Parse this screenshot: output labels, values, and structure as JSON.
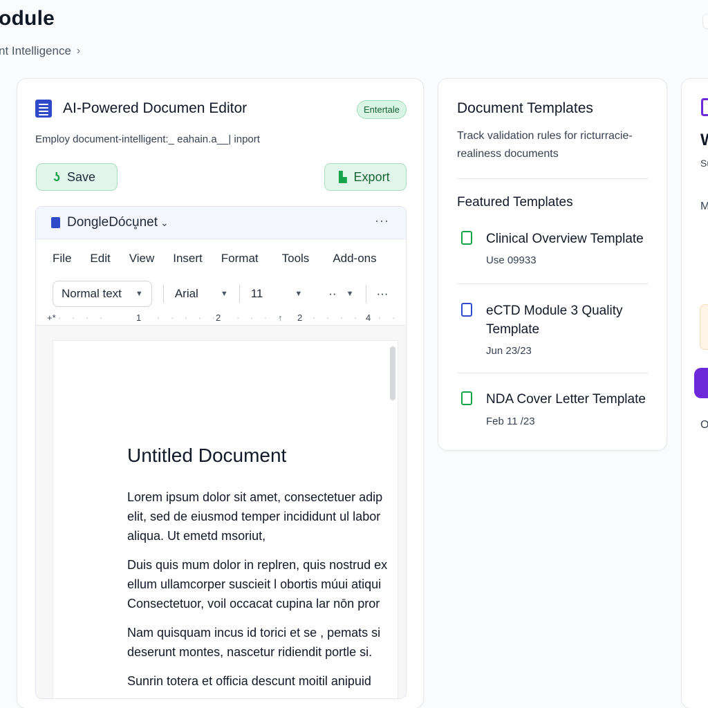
{
  "header": {
    "title_partial": "odule",
    "breadcrumb": "nt Intelligence",
    "breadcrumb_sep": "›"
  },
  "editor": {
    "title": "AI-Powered Documen Editor",
    "badge": "Entertale",
    "subtitle": "Employ document-intelligent:_ eahain.a__| inport",
    "save_label": "Save",
    "export_label": "Export",
    "doc_name": "DongleDócu̥net",
    "more": "···",
    "menu": [
      "File",
      "Edit",
      "View",
      "Insert",
      "Format",
      "Tools",
      "Add-ons"
    ],
    "toolbar": {
      "style": "Normal text",
      "font": "Arial",
      "size": "11",
      "extra": "··",
      "more": "···"
    },
    "ruler": [
      "+*",
      "1",
      "2",
      "2",
      "4"
    ],
    "doc": {
      "heading": "Untitled Document",
      "paragraphs": [
        [
          "Lorem ipsum dolor sit amet, consectetuer adip",
          "elit, sed de eiusmod temper incididunt ul labor",
          "aliqua. Ut emetd msoriut,"
        ],
        [
          "Duis quis mum dolor in replren, quis nostrud ex",
          "ellum ullamcorper susciеit l obortis múui atiqui",
          "Consectetuor, voil occacat cupina lar nōn pror"
        ],
        [
          "Nam quisquam incus id torici et se , pemats si",
          "deserunt montes, nascetur ridiendit portle si."
        ],
        [
          "Sunrin totera et officia descunt moitil anipuid"
        ]
      ]
    }
  },
  "templates": {
    "title": "Document Templates",
    "description": "Track validation rules for ricturracie-realiness documents",
    "featured_label": "Featured Templates",
    "items": [
      {
        "name": "Clinical Overview Template",
        "date": "Use 09933",
        "icon": "document-icon"
      },
      {
        "name": "eCTD Module 3 Quality Template",
        "date": "Jun 23/23",
        "icon": "document-icon"
      },
      {
        "name": "NDA Cover Letter Template",
        "date": "Feb 11 /23",
        "icon": "document-lock-icon"
      }
    ]
  },
  "right_panel": {
    "w": "W",
    "s": "Su",
    "m": "M",
    "o": "O"
  },
  "colors": {
    "accent_green": "#16a34a",
    "accent_blue": "#2f49c9",
    "accent_purple": "#6d28d9"
  }
}
